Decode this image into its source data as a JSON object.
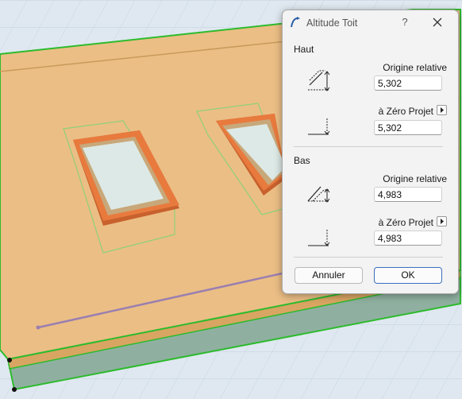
{
  "dialog": {
    "title": "Altitude Toit",
    "help_label": "?",
    "top": {
      "heading": "Haut",
      "relative_label": "Origine relative",
      "relative_value": "5,302",
      "project_label": "à Zéro Projet",
      "project_value": "5,302"
    },
    "bottom": {
      "heading": "Bas",
      "relative_label": "Origine relative",
      "relative_value": "4,983",
      "project_label": "à Zéro Projet",
      "project_value": "4,983"
    },
    "cancel_label": "Annuler",
    "ok_label": "OK"
  },
  "colors": {
    "roof": "#ebbe85",
    "roof_edge": "#2dbb2d",
    "glass": "#d8e8e4",
    "frame": "#e0703a",
    "accent": "#3b6fbf"
  },
  "icons": [
    "roof-altitude-icon",
    "close-icon",
    "dropdown-arrow-icon",
    "level-marker-icon"
  ]
}
